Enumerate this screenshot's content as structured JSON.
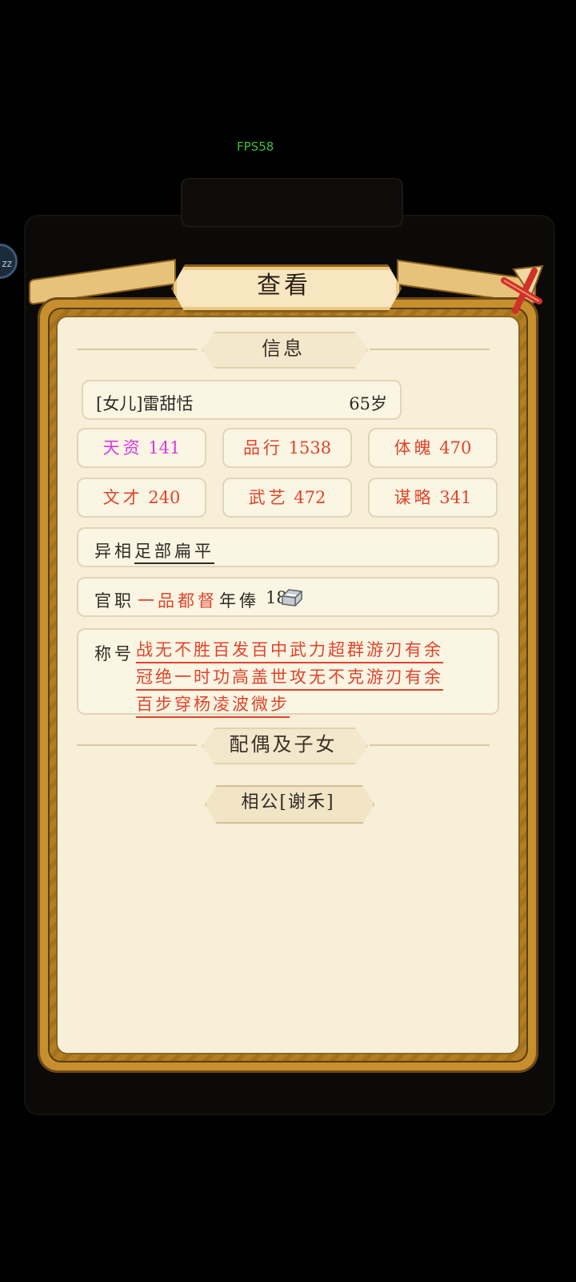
{
  "fps": "FPS58",
  "side_badge": "zz",
  "dialog": {
    "title": "查看"
  },
  "sections": {
    "info": "信息",
    "spouse": "配偶及子女"
  },
  "person": {
    "name": "[女儿]雷甜恬",
    "age": "65岁"
  },
  "stats": [
    {
      "label": "天资",
      "value": "141",
      "color": "#d73be0"
    },
    {
      "label": "品行",
      "value": "1538",
      "color": "#e0442c"
    },
    {
      "label": "体魄",
      "value": "470",
      "color": "#e0442c"
    },
    {
      "label": "文才",
      "value": "240",
      "color": "#e0442c"
    },
    {
      "label": "武艺",
      "value": "472",
      "color": "#e0442c"
    },
    {
      "label": "谋略",
      "value": "341",
      "color": "#e0442c"
    }
  ],
  "appearance": {
    "label": "异相",
    "value": "足部扁平"
  },
  "office": {
    "label": "官职",
    "title": "一品都督",
    "salary_label": "年俸",
    "salary": "18",
    "icon": "silver-ingot-icon"
  },
  "honors": {
    "label": "称号",
    "items": [
      "战无不胜",
      "百发百中",
      "武力超群",
      "游刃有余",
      "冠绝一时",
      "功高盖世",
      "攻无不克",
      "游刃有余",
      "百步穿杨",
      "凌波微步"
    ]
  },
  "spouse": {
    "label": "相公[谢禾]"
  },
  "colors": {
    "accent_red": "#e0442c",
    "accent_purple": "#d73be0",
    "parchment": "#f7efd7",
    "gold": "#c78f2e"
  }
}
